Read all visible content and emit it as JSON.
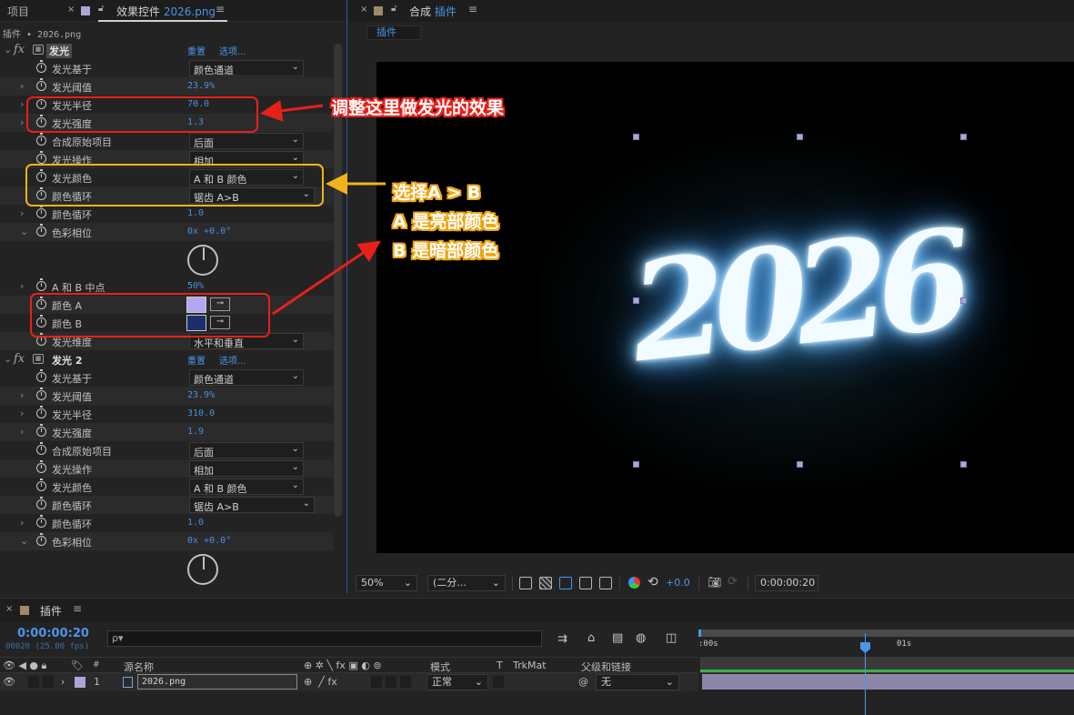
{
  "panels": {
    "project_tab": "项目",
    "effect_controls_tab": "效果控件",
    "effect_controls_file": "2026.png",
    "effect_controls_subtitle": "插件 • 2026.png",
    "comp_tab_prefix": "合成",
    "comp_tab_name": "插件",
    "comp_flowchart_chip": "插件"
  },
  "effect1": {
    "name": "发光",
    "reset": "重置",
    "options": "选项...",
    "params": [
      {
        "label": "发光基于",
        "dropdown": "颜色通道"
      },
      {
        "label": "发光阈值",
        "value": "23.9%"
      },
      {
        "label": "发光半径",
        "value": "70.0"
      },
      {
        "label": "发光强度",
        "value": "1.3"
      },
      {
        "label": "合成原始项目",
        "dropdown": "后面"
      },
      {
        "label": "发光操作",
        "dropdown": "相加"
      },
      {
        "label": "发光颜色",
        "dropdown": "A 和 B 颜色"
      },
      {
        "label": "颜色循环",
        "dropdown": "锯齿 A>B"
      },
      {
        "label": "颜色循环",
        "value": "1.0"
      },
      {
        "label": "色彩相位",
        "value": "0x +0.0°"
      },
      {
        "label": "A 和 B 中点",
        "value": "50%"
      },
      {
        "label": "颜色 A"
      },
      {
        "label": "颜色 B"
      },
      {
        "label": "发光维度",
        "dropdown": "水平和垂直"
      }
    ],
    "color_a": "#b3a8f0",
    "color_b": "#1c2e6b"
  },
  "effect2": {
    "name": "发光 2",
    "reset": "重置",
    "options": "选项...",
    "params": [
      {
        "label": "发光基于",
        "dropdown": "颜色通道"
      },
      {
        "label": "发光阈值",
        "value": "23.9%"
      },
      {
        "label": "发光半径",
        "value": "310.0"
      },
      {
        "label": "发光强度",
        "value": "1.9"
      },
      {
        "label": "合成原始项目",
        "dropdown": "后面"
      },
      {
        "label": "发光操作",
        "dropdown": "相加"
      },
      {
        "label": "发光颜色",
        "dropdown": "A 和 B 颜色"
      },
      {
        "label": "颜色循环",
        "dropdown": "锯齿 A>B"
      },
      {
        "label": "颜色循环",
        "value": "1.0"
      },
      {
        "label": "色彩相位",
        "value": "0x +0.0°"
      }
    ]
  },
  "annotations": {
    "radius_note": "调整这里做发光的效果",
    "color_note_line1": "选择A > B",
    "color_note_line2": "A 是亮部颜色",
    "color_note_line3": "B 是暗部颜色"
  },
  "viewer": {
    "artwork_text": "2026",
    "zoom": "50%",
    "resolution": "(二分...",
    "exposure": "+0.0",
    "timecode": "0:00:00:20"
  },
  "timeline": {
    "tab": "插件",
    "current_time": "0:00:00:20",
    "frame_info": "00020 (25.00 fps)",
    "search_placeholder": "ρ▾",
    "ruler_start": ":00s",
    "ruler_1s": "01s",
    "columns": {
      "num": "#",
      "source_name": "源名称",
      "mode": "模式",
      "t": "T",
      "trkmat": "TrkMat",
      "parent": "父级和链接"
    },
    "layer": {
      "index": "1",
      "name": "2026.png",
      "mode": "正常",
      "parent": "无"
    }
  },
  "colors": {
    "accent_blue": "#4c95e8",
    "annotation_red": "#e8201a",
    "annotation_yellow": "#f2b31c",
    "layer_label": "#a9a6d8"
  }
}
